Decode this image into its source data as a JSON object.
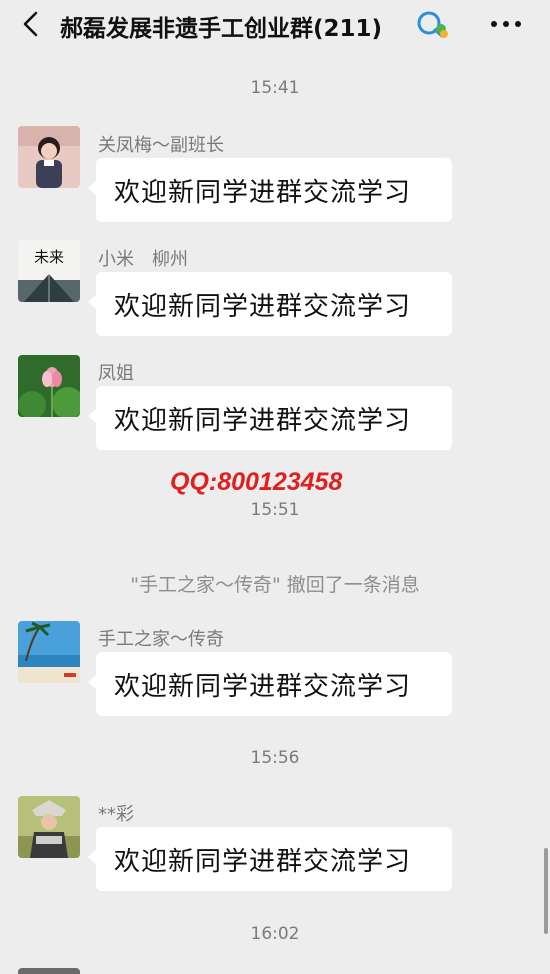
{
  "header": {
    "title": "郝磊发展非遗手工创业群(211)",
    "back_icon": "chevron-left-icon",
    "group_icon": "group-chat-icon",
    "more_icon": "more-dots-icon"
  },
  "timestamps": {
    "t1": "15:41",
    "t2": "15:51",
    "t3": "15:56",
    "t4": "16:02"
  },
  "watermark": "QQ:800123458",
  "system_message": "\"手工之家～传奇\" 撤回了一条消息",
  "messages": [
    {
      "sender": "关凤梅～副班长",
      "text": "欢迎新同学进群交流学习",
      "avatar": "girl-photo-avatar"
    },
    {
      "sender": "小米　柳州",
      "text": "欢迎新同学进群交流学习",
      "avatar": "future-calligraphy-avatar"
    },
    {
      "sender": "凤姐",
      "text": "欢迎新同学进群交流学习",
      "avatar": "lotus-avatar"
    },
    {
      "sender": "手工之家～传奇",
      "text": "欢迎新同学进群交流学习",
      "avatar": "beach-avatar"
    },
    {
      "sender": "**彩",
      "text": "欢迎新同学进群交流学习",
      "avatar": "child-costume-avatar"
    }
  ],
  "colors": {
    "background": "#ededed",
    "bubble": "#ffffff",
    "watermark": "#e02020"
  }
}
